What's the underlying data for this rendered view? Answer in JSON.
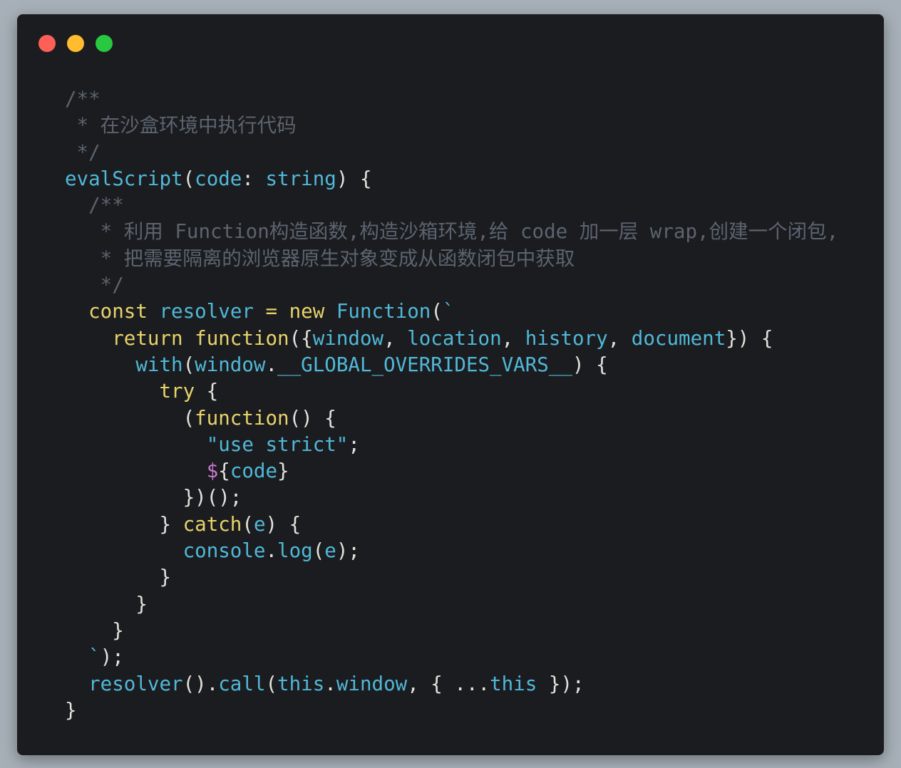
{
  "window": {
    "controls": [
      {
        "name": "close-button",
        "color": "#fe5f57"
      },
      {
        "name": "minimize-button",
        "color": "#febc2e"
      },
      {
        "name": "zoom-button",
        "color": "#28c840"
      }
    ]
  },
  "editor": {
    "lines": [
      [
        [
          "comment",
          "/**"
        ]
      ],
      [
        [
          "comment",
          " * 在沙盒环境中执行代码"
        ]
      ],
      [
        [
          "comment",
          " */"
        ]
      ],
      [
        [
          "id",
          "evalScript"
        ],
        [
          "plain",
          "("
        ],
        [
          "id",
          "code"
        ],
        [
          "plain",
          ": "
        ],
        [
          "id",
          "string"
        ],
        [
          "plain",
          ") {"
        ]
      ],
      [
        [
          "comment",
          "  /**"
        ]
      ],
      [
        [
          "comment",
          "   * 利用 Function构造函数,构造沙箱环境,给 code 加一层 wrap,创建一个闭包,"
        ]
      ],
      [
        [
          "comment",
          "   * 把需要隔离的浏览器原生对象变成从函数闭包中获取"
        ]
      ],
      [
        [
          "comment",
          "   */"
        ]
      ],
      [
        [
          "plain",
          "  "
        ],
        [
          "kw",
          "const"
        ],
        [
          "plain",
          " "
        ],
        [
          "id",
          "resolver"
        ],
        [
          "plain",
          " "
        ],
        [
          "kw",
          "="
        ],
        [
          "plain",
          " "
        ],
        [
          "kw",
          "new"
        ],
        [
          "plain",
          " "
        ],
        [
          "id",
          "Function"
        ],
        [
          "plain",
          "("
        ],
        [
          "str",
          "`"
        ]
      ],
      [
        [
          "plain",
          "    "
        ],
        [
          "kw",
          "return"
        ],
        [
          "plain",
          " "
        ],
        [
          "kw",
          "function"
        ],
        [
          "plain",
          "({"
        ],
        [
          "id",
          "window"
        ],
        [
          "plain",
          ", "
        ],
        [
          "id",
          "location"
        ],
        [
          "plain",
          ", "
        ],
        [
          "id",
          "history"
        ],
        [
          "plain",
          ", "
        ],
        [
          "id",
          "document"
        ],
        [
          "plain",
          "}) {"
        ]
      ],
      [
        [
          "plain",
          "      "
        ],
        [
          "id",
          "with"
        ],
        [
          "plain",
          "("
        ],
        [
          "id",
          "window"
        ],
        [
          "plain",
          "."
        ],
        [
          "id",
          "__GLOBAL_OVERRIDES_VARS__"
        ],
        [
          "plain",
          ") {"
        ]
      ],
      [
        [
          "plain",
          "        "
        ],
        [
          "kw",
          "try"
        ],
        [
          "plain",
          " {"
        ]
      ],
      [
        [
          "plain",
          "          ("
        ],
        [
          "kw",
          "function"
        ],
        [
          "plain",
          "() {"
        ]
      ],
      [
        [
          "plain",
          "            "
        ],
        [
          "str",
          "\"use strict\""
        ],
        [
          "plain",
          ";"
        ]
      ],
      [
        [
          "plain",
          "            "
        ],
        [
          "interp",
          "$"
        ],
        [
          "plain",
          "{"
        ],
        [
          "id",
          "code"
        ],
        [
          "plain",
          "}"
        ]
      ],
      [
        [
          "plain",
          "          })();"
        ]
      ],
      [
        [
          "plain",
          "        } "
        ],
        [
          "kw",
          "catch"
        ],
        [
          "plain",
          "("
        ],
        [
          "id",
          "e"
        ],
        [
          "plain",
          ") {"
        ]
      ],
      [
        [
          "plain",
          "          "
        ],
        [
          "id",
          "console"
        ],
        [
          "plain",
          "."
        ],
        [
          "id",
          "log"
        ],
        [
          "plain",
          "("
        ],
        [
          "id",
          "e"
        ],
        [
          "plain",
          ");"
        ]
      ],
      [
        [
          "plain",
          "        }"
        ]
      ],
      [
        [
          "plain",
          "      }"
        ]
      ],
      [
        [
          "plain",
          "    }"
        ]
      ],
      [
        [
          "plain",
          "  "
        ],
        [
          "str",
          "`"
        ],
        [
          "plain",
          ");"
        ]
      ],
      [
        [
          "plain",
          "  "
        ],
        [
          "id",
          "resolver"
        ],
        [
          "plain",
          "()."
        ],
        [
          "id",
          "call"
        ],
        [
          "plain",
          "("
        ],
        [
          "id",
          "this"
        ],
        [
          "plain",
          "."
        ],
        [
          "id",
          "window"
        ],
        [
          "plain",
          ", { ..."
        ],
        [
          "id",
          "this"
        ],
        [
          "plain",
          " });"
        ]
      ],
      [
        [
          "plain",
          "}"
        ]
      ]
    ]
  }
}
